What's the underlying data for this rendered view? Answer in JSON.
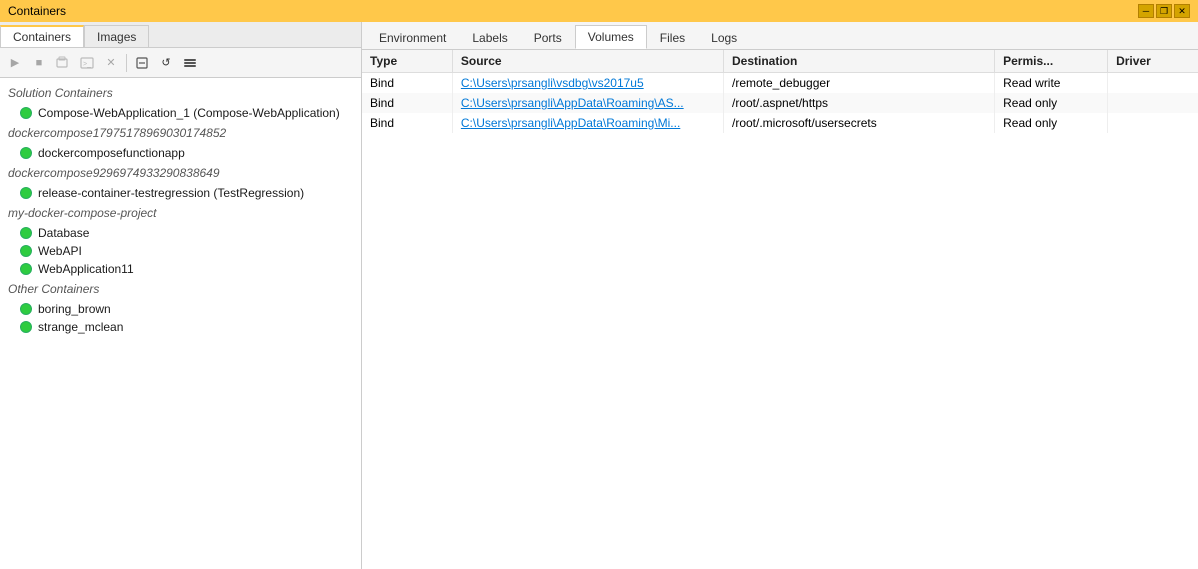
{
  "titleBar": {
    "title": "Containers",
    "controls": [
      "minimize",
      "restore",
      "close"
    ]
  },
  "leftPanel": {
    "tabs": [
      {
        "id": "containers",
        "label": "Containers",
        "active": true
      },
      {
        "id": "images",
        "label": "Images",
        "active": false
      }
    ],
    "toolbar": {
      "buttons": [
        {
          "id": "run",
          "icon": "▶",
          "label": "Run",
          "enabled": false
        },
        {
          "id": "stop",
          "icon": "■",
          "label": "Stop",
          "enabled": false
        },
        {
          "id": "attach",
          "icon": "⊡",
          "label": "Attach",
          "enabled": false
        },
        {
          "id": "terminal",
          "icon": "⊞",
          "label": "Terminal",
          "enabled": false
        },
        {
          "id": "remove",
          "icon": "✕",
          "label": "Remove",
          "enabled": false
        },
        {
          "id": "prune",
          "icon": "⊟",
          "label": "Prune",
          "enabled": true
        },
        {
          "id": "refresh",
          "icon": "↺",
          "label": "Refresh",
          "enabled": true
        },
        {
          "id": "settings",
          "icon": "⊞",
          "label": "Settings",
          "enabled": true
        }
      ]
    },
    "groups": [
      {
        "id": "solution-containers",
        "header": "Solution Containers",
        "items": [
          {
            "id": "compose-webapp",
            "label": "Compose-WebApplication_1 (Compose-WebApplication)",
            "hasIndicator": true,
            "level": 0
          }
        ]
      },
      {
        "id": "dockercompose1",
        "header": "dockercompose17975178969030174852",
        "items": [
          {
            "id": "dockercomposefunctionapp",
            "label": "dockercomposefunctionapp",
            "hasIndicator": true,
            "level": 0
          }
        ]
      },
      {
        "id": "dockercompose2",
        "header": "dockercompose929697493329083864​9",
        "items": [
          {
            "id": "release-container",
            "label": "release-container-testregression (TestRegression)",
            "hasIndicator": true,
            "level": 0
          }
        ]
      },
      {
        "id": "my-docker-compose",
        "header": "my-docker-compose-project",
        "items": [
          {
            "id": "database",
            "label": "Database",
            "hasIndicator": true,
            "level": 0
          },
          {
            "id": "webapi",
            "label": "WebAPI",
            "hasIndicator": true,
            "level": 0
          },
          {
            "id": "webapplication11",
            "label": "WebApplication11",
            "hasIndicator": true,
            "level": 0
          }
        ]
      },
      {
        "id": "other-containers",
        "header": "Other Containers",
        "items": [
          {
            "id": "boring-brown",
            "label": "boring_brown",
            "hasIndicator": true,
            "level": 0
          },
          {
            "id": "strange-mclean",
            "label": "strange_mclean",
            "hasIndicator": true,
            "level": 0
          }
        ]
      }
    ]
  },
  "rightPanel": {
    "tabs": [
      {
        "id": "environment",
        "label": "Environment",
        "active": false
      },
      {
        "id": "labels",
        "label": "Labels",
        "active": false
      },
      {
        "id": "ports",
        "label": "Ports",
        "active": false
      },
      {
        "id": "volumes",
        "label": "Volumes",
        "active": true
      },
      {
        "id": "files",
        "label": "Files",
        "active": false
      },
      {
        "id": "logs",
        "label": "Logs",
        "active": false
      }
    ],
    "table": {
      "columns": [
        {
          "id": "type",
          "label": "Type"
        },
        {
          "id": "source",
          "label": "Source"
        },
        {
          "id": "destination",
          "label": "Destination"
        },
        {
          "id": "permissions",
          "label": "Permis..."
        },
        {
          "id": "driver",
          "label": "Driver"
        }
      ],
      "rows": [
        {
          "type": "Bind",
          "source": "C:\\Users\\prsangli\\vsdbg\\vs2017u5",
          "sourceDisplay": "C:\\Users\\prsangli\\vsdbg\\vs2017u5",
          "destination": "/remote_debugger",
          "permissions": "Read write",
          "driver": ""
        },
        {
          "type": "Bind",
          "source": "C:\\Users\\prsangli\\AppData\\Roaming\\AS...",
          "sourceDisplay": "C:\\Users\\prsangli\\AppData\\Roaming\\AS...",
          "destination": "/root/.aspnet/https",
          "permissions": "Read only",
          "driver": ""
        },
        {
          "type": "Bind",
          "source": "C:\\Users\\prsangli\\AppData\\Roaming\\Mi...",
          "sourceDisplay": "C:\\Users\\prsangli\\AppData\\Roaming\\Mi...",
          "destination": "/root/.microsoft/usersecrets",
          "permissions": "Read only",
          "driver": ""
        }
      ]
    }
  }
}
